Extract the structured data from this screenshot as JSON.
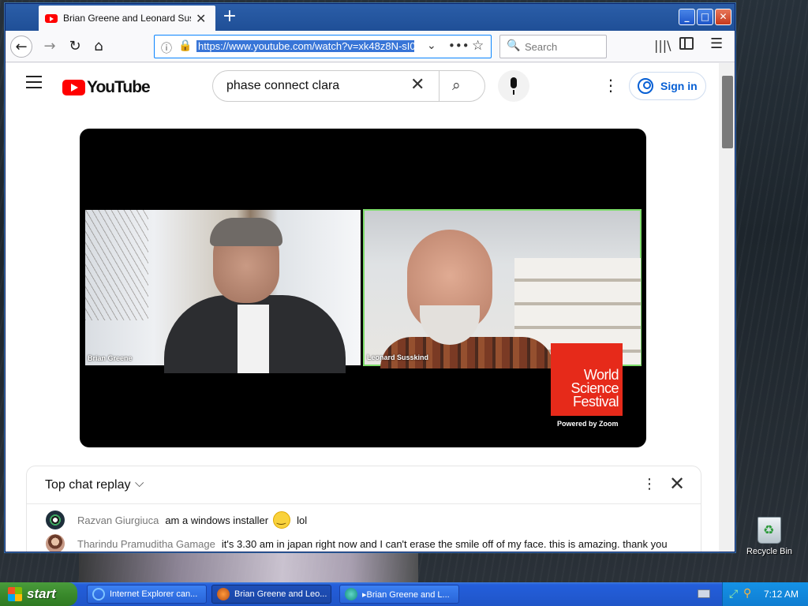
{
  "browser": {
    "tab_title": "Brian Greene and Leonard Susskind",
    "tab_close": "✕",
    "new_tab": "+",
    "window_controls": {
      "minimize": "_",
      "maximize": "□",
      "close": "✕"
    },
    "nav": {
      "back": "←",
      "forward": "→",
      "reload": "↻",
      "home": "⌂"
    },
    "url": "https://www.youtube.com/watch?v=xk48z8N-sI0",
    "url_icons": {
      "info": "ⓘ",
      "lock": "🔒",
      "dropdown": "⌄",
      "more": "•••",
      "bookmark": "☆"
    },
    "search_placeholder": "Search",
    "search_engine_icon": "🔍",
    "library_icon": "|||\\",
    "menu_icon": "☰"
  },
  "youtube": {
    "logo_text": "YouTube",
    "search_value": "phase connect clara",
    "search_clear": "✕",
    "search_button": "⌕",
    "more_dots": "⋮",
    "sign_in": "Sign in",
    "video": {
      "left_name": "Brian Greene",
      "right_name": "Leonard Susskind",
      "brand_line1": "World",
      "brand_line2": "Science",
      "brand_line3": "Festival",
      "caption": "Powered by Zoom"
    },
    "chat": {
      "title": "Top chat replay",
      "chevron": "⌵",
      "more": "⋮",
      "close": "✕",
      "messages": [
        {
          "author": "Razvan Giurgiuca",
          "text": "am a windows installer",
          "suffix": "lol"
        },
        {
          "author": "Tharindu Pramuditha Gamage",
          "text": "it's 3.30 am in japan right now and I can't erase the smile off of my face. this is amazing. thank you"
        }
      ]
    }
  },
  "desktop": {
    "recycle_bin": "Recycle Bin"
  },
  "taskbar": {
    "start": "start",
    "tasks": [
      {
        "label": "Internet Explorer can..."
      },
      {
        "label": "Brian Greene and Leo..."
      },
      {
        "label": "▸Brian Greene and L..."
      }
    ],
    "tray_net": "⤢",
    "tray_search": "⚲",
    "clock": "7:12 AM"
  }
}
